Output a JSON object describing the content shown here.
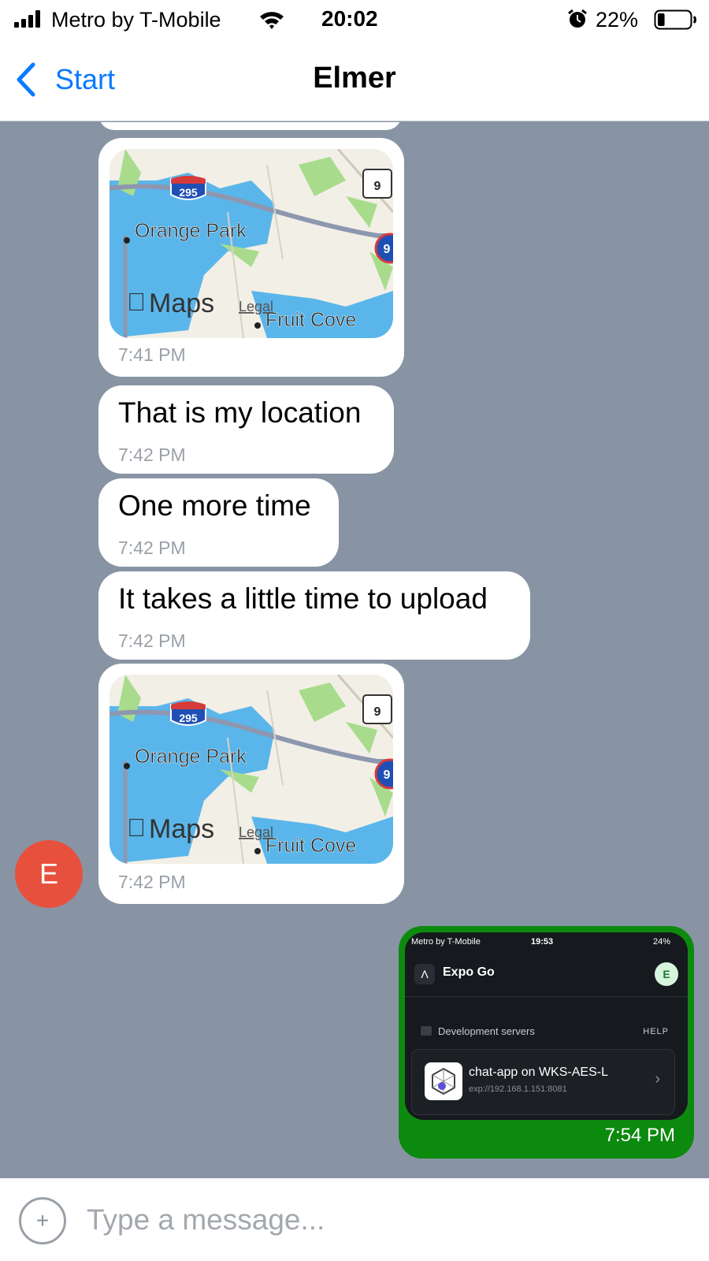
{
  "status_bar": {
    "carrier": "Metro by T-Mobile",
    "time": "20:02",
    "battery": "22%",
    "battery_level": 0.22,
    "icons": [
      "signal-icon",
      "wifi-icon",
      "alarm-icon",
      "battery-icon"
    ]
  },
  "nav": {
    "back_label": "Start",
    "title": "Elmer"
  },
  "messages": [
    {
      "type": "map",
      "labels": {
        "route": "295",
        "state_route": "9",
        "interstate": "9",
        "city": "Orange Park",
        "town": "Fruit Cove",
        "brand": "Maps",
        "legal": "Legal"
      },
      "time": "7:41 PM"
    },
    {
      "type": "text",
      "text": "That is my location",
      "time": "7:42 PM"
    },
    {
      "type": "text",
      "text": "One more time",
      "time": "7:42 PM"
    },
    {
      "type": "text",
      "text": "It takes a little time to upload",
      "time": "7:42 PM"
    },
    {
      "type": "map",
      "labels": {
        "route": "295",
        "state_route": "9",
        "interstate": "9",
        "city": "Orange Park",
        "town": "Fruit Cove",
        "brand": "Maps",
        "legal": "Legal"
      },
      "time": "7:42 PM"
    }
  ],
  "avatar": {
    "initial": "E",
    "color": "#e8503e"
  },
  "sent_image": {
    "time": "7:54 PM",
    "bubble_color": "#0c8a0e",
    "screenshot": {
      "carrier": "Metro by T-Mobile",
      "time": "19:53",
      "battery": "24%",
      "app_name": "Expo Go",
      "user_initial": "E",
      "section": "Development servers",
      "help": "HELP",
      "server_name": "chat-app on WKS-AES-L",
      "server_url": "exp://192.168.1.151:8081"
    }
  },
  "input": {
    "placeholder": "Type a message..."
  },
  "colors": {
    "accent": "#0a7aff",
    "chat_background": "#8894a4",
    "bubble": "#ffffff"
  }
}
